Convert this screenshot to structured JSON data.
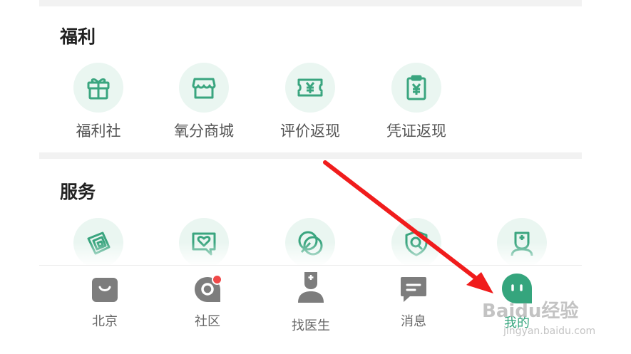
{
  "welfare": {
    "title": "福利",
    "items": [
      {
        "label": "福利社",
        "icon": "gift-icon"
      },
      {
        "label": "氧分商城",
        "icon": "shop-icon"
      },
      {
        "label": "评价返现",
        "icon": "ticket-yen-icon"
      },
      {
        "label": "凭证返现",
        "icon": "receipt-yen-icon"
      }
    ]
  },
  "services": {
    "title": "服务",
    "items": [
      {
        "icon": "layers-icon"
      },
      {
        "icon": "chat-heart-icon"
      },
      {
        "icon": "leaf-icon"
      },
      {
        "icon": "shield-search-icon"
      },
      {
        "icon": "doctor-icon"
      }
    ]
  },
  "tabbar": {
    "tabs": [
      {
        "label": "北京",
        "icon": "bag-icon"
      },
      {
        "label": "社区",
        "icon": "community-icon",
        "badge": true
      },
      {
        "label": "找医生",
        "icon": "doctor-tab-icon"
      },
      {
        "label": "消息",
        "icon": "message-icon"
      },
      {
        "label": "我的",
        "icon": "profile-icon",
        "active": true
      }
    ]
  },
  "watermark": {
    "text": "Baidu经验",
    "sub": "jingyan.baidu.com"
  },
  "colors": {
    "accent": "#35a57d",
    "icon_bg": "#eaf6f1",
    "inactive": "#7a7a7a",
    "arrow": "#f01c1c"
  }
}
